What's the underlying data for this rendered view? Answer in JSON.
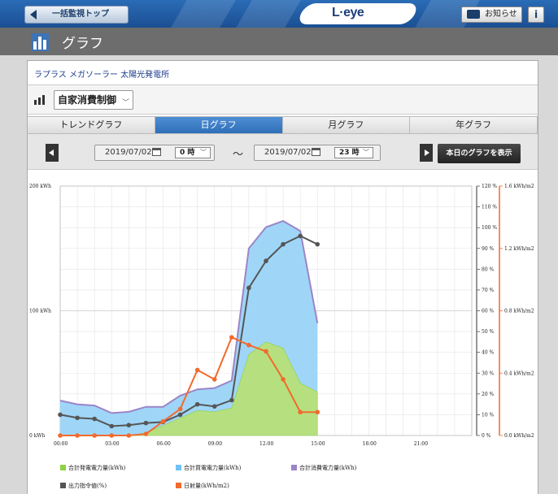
{
  "header": {
    "back_label": "一括監視トップ",
    "logo": "L·eye",
    "notice_label": "お知らせ",
    "info_label": "i"
  },
  "page": {
    "title": "グラフ"
  },
  "plant": {
    "name": "ラプラス メガソーラー 太陽光発電所"
  },
  "selector": {
    "value": "自家消費制御"
  },
  "tabs": [
    {
      "label": "トレンドグラフ",
      "active": false
    },
    {
      "label": "日グラフ",
      "active": true
    },
    {
      "label": "月グラフ",
      "active": false
    },
    {
      "label": "年グラフ",
      "active": false
    }
  ],
  "range": {
    "start_date": "2019/07/02",
    "start_hour": "0 時",
    "separator": "～",
    "end_date": "2019/07/02",
    "end_hour": "23 時",
    "today_button": "本日のグラフを表示"
  },
  "colors": {
    "generation": "#8ed144",
    "purchase": "#72c2f2",
    "consumption": "#9c85c8",
    "output_command": "#555555",
    "irradiance": "#f26a2c"
  },
  "chart_data": {
    "type": "area",
    "x": [
      "00:00",
      "01:00",
      "02:00",
      "03:00",
      "04:00",
      "05:00",
      "06:00",
      "07:00",
      "08:00",
      "09:00",
      "10:00",
      "11:00",
      "12:00",
      "13:00",
      "14:00",
      "15:00"
    ],
    "xticks": [
      "00:00",
      "03:00",
      "06:00",
      "09:00",
      "12:00",
      "15:00",
      "18:00",
      "21:00"
    ],
    "xlim_hours": [
      0,
      24
    ],
    "left_axis": {
      "ticks": [
        "200 kWh",
        "100 kWh",
        "0 kWh"
      ],
      "ylim": [
        0,
        200
      ]
    },
    "right_axis_percent": {
      "ticks": [
        "120 %",
        "110 %",
        "100 %",
        "90 %",
        "80 %",
        "70 %",
        "60 %",
        "50 %",
        "40 %",
        "30 %",
        "20 %",
        "10 %",
        "0 %"
      ],
      "ylim": [
        0,
        120
      ]
    },
    "right_axis_irradiance": {
      "ticks": [
        "1.6 kWh/m2",
        "1.2 kWh/m2",
        "0.8 kWh/m2",
        "0.4 kWh/m2",
        "0.0 kWh/m2"
      ],
      "ylim": [
        0,
        1.6
      ]
    },
    "series": [
      {
        "name": "合計発電電力量(kWh)",
        "axis": "left",
        "kind": "area",
        "values": [
          0,
          0,
          0,
          0,
          0,
          2,
          8,
          14,
          20,
          19,
          22,
          65,
          75,
          70,
          42,
          35
        ]
      },
      {
        "name": "合計買電電力量(kWh)",
        "axis": "left",
        "kind": "area-stack",
        "values": [
          28,
          25,
          24,
          18,
          19,
          21,
          15,
          18,
          17,
          19,
          22,
          85,
          92,
          102,
          122,
          55
        ]
      },
      {
        "name": "合計消費電力量(kWh)",
        "axis": "left",
        "kind": "line",
        "values": [
          28,
          25,
          24,
          18,
          19,
          23,
          23,
          32,
          37,
          38,
          44,
          150,
          167,
          172,
          164,
          90
        ]
      },
      {
        "name": "出力指令値(%)",
        "axis": "right_percent",
        "kind": "line",
        "values": [
          10,
          8.5,
          8,
          4.5,
          5,
          6,
          6.5,
          10,
          15,
          14,
          17,
          71,
          84,
          92,
          96,
          92
        ]
      },
      {
        "name": "日射量(kWh/m2)",
        "axis": "right_irradiance",
        "kind": "line",
        "values": [
          0,
          0,
          0,
          0,
          0,
          0.01,
          0.09,
          0.17,
          0.42,
          0.36,
          0.63,
          0.58,
          0.54,
          0.36,
          0.15,
          0.15
        ]
      }
    ],
    "grid": true
  }
}
